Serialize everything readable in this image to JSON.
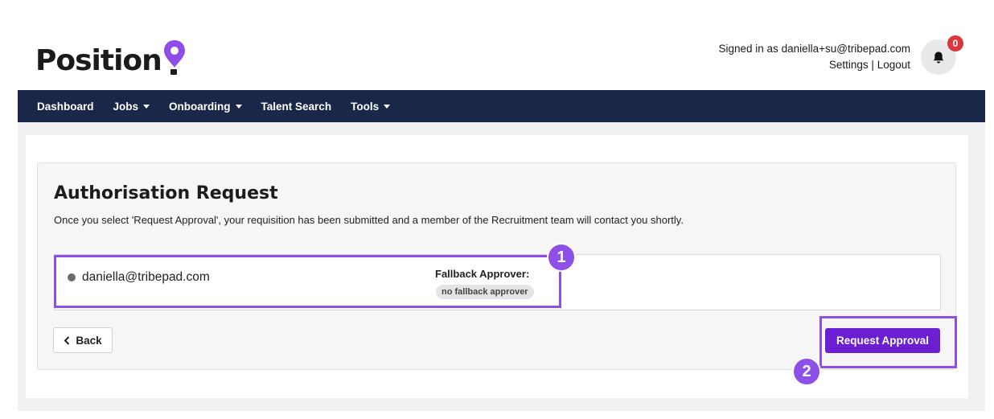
{
  "header": {
    "logo_text": "Position",
    "signed_in_prefix": "Signed in as",
    "user_email": "daniella+su@tribepad.com",
    "settings_label": "Settings",
    "separator": "|",
    "logout_label": "Logout",
    "notification_count": "0"
  },
  "nav": {
    "items": [
      {
        "label": "Dashboard",
        "has_caret": false
      },
      {
        "label": "Jobs",
        "has_caret": true
      },
      {
        "label": "Onboarding",
        "has_caret": true
      },
      {
        "label": "Talent Search",
        "has_caret": false
      },
      {
        "label": "Tools",
        "has_caret": true
      }
    ]
  },
  "main": {
    "title": "Authorisation Request",
    "description": "Once you select 'Request Approval', your requisition has been submitted and a member of the Recruitment team will contact you shortly.",
    "approver_email": "daniella@tribepad.com",
    "fallback_label": "Fallback Approver:",
    "fallback_value": "no fallback approver",
    "back_label": "Back",
    "request_label": "Request Approval"
  },
  "annotations": {
    "step_1": "1",
    "step_2": "2"
  },
  "colors": {
    "nav_bg": "#192748",
    "primary_button": "#6b1fd1",
    "annotation": "#8d4fe6",
    "logo_pin": "#8e4de8",
    "badge_red": "#d9363e"
  }
}
